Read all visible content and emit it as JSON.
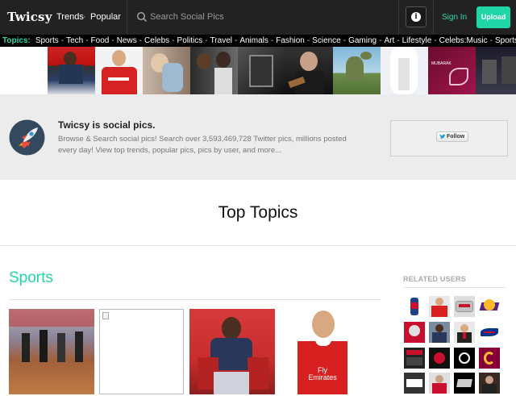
{
  "navbar": {
    "brand": "Twicsy",
    "links": [
      "Trends",
      "Popular"
    ],
    "separator": "·",
    "search_placeholder": "Search Social Pics",
    "info_icon": "info-icon",
    "signin_label": "Sign In",
    "upload_label": "Upload"
  },
  "ticker": {
    "label": "Topics:",
    "items": [
      "Sports",
      "Tech",
      "Food",
      "News",
      "Celebs",
      "Politics",
      "Travel",
      "Animals",
      "Fashion",
      "Science",
      "Gaming",
      "Art",
      "Lifestyle",
      "Celebs:Music",
      "Sports:NFL",
      "Sp"
    ],
    "separator": "-"
  },
  "hero": {
    "title": "Twicsy is social pics.",
    "description": "Browse & Search social pics! Search over 3,593,469,728 Twitter pics, millions posted every day! View top trends, popular pics, pics by user, and more...",
    "follow_label": "Follow"
  },
  "main": {
    "heading": "Top Topics",
    "section_title": "Sports",
    "related_title": "RELATED USERS"
  },
  "colors": {
    "accent": "#21d6a6",
    "navbar_bg": "#222222",
    "hero_bg": "#ececec"
  }
}
